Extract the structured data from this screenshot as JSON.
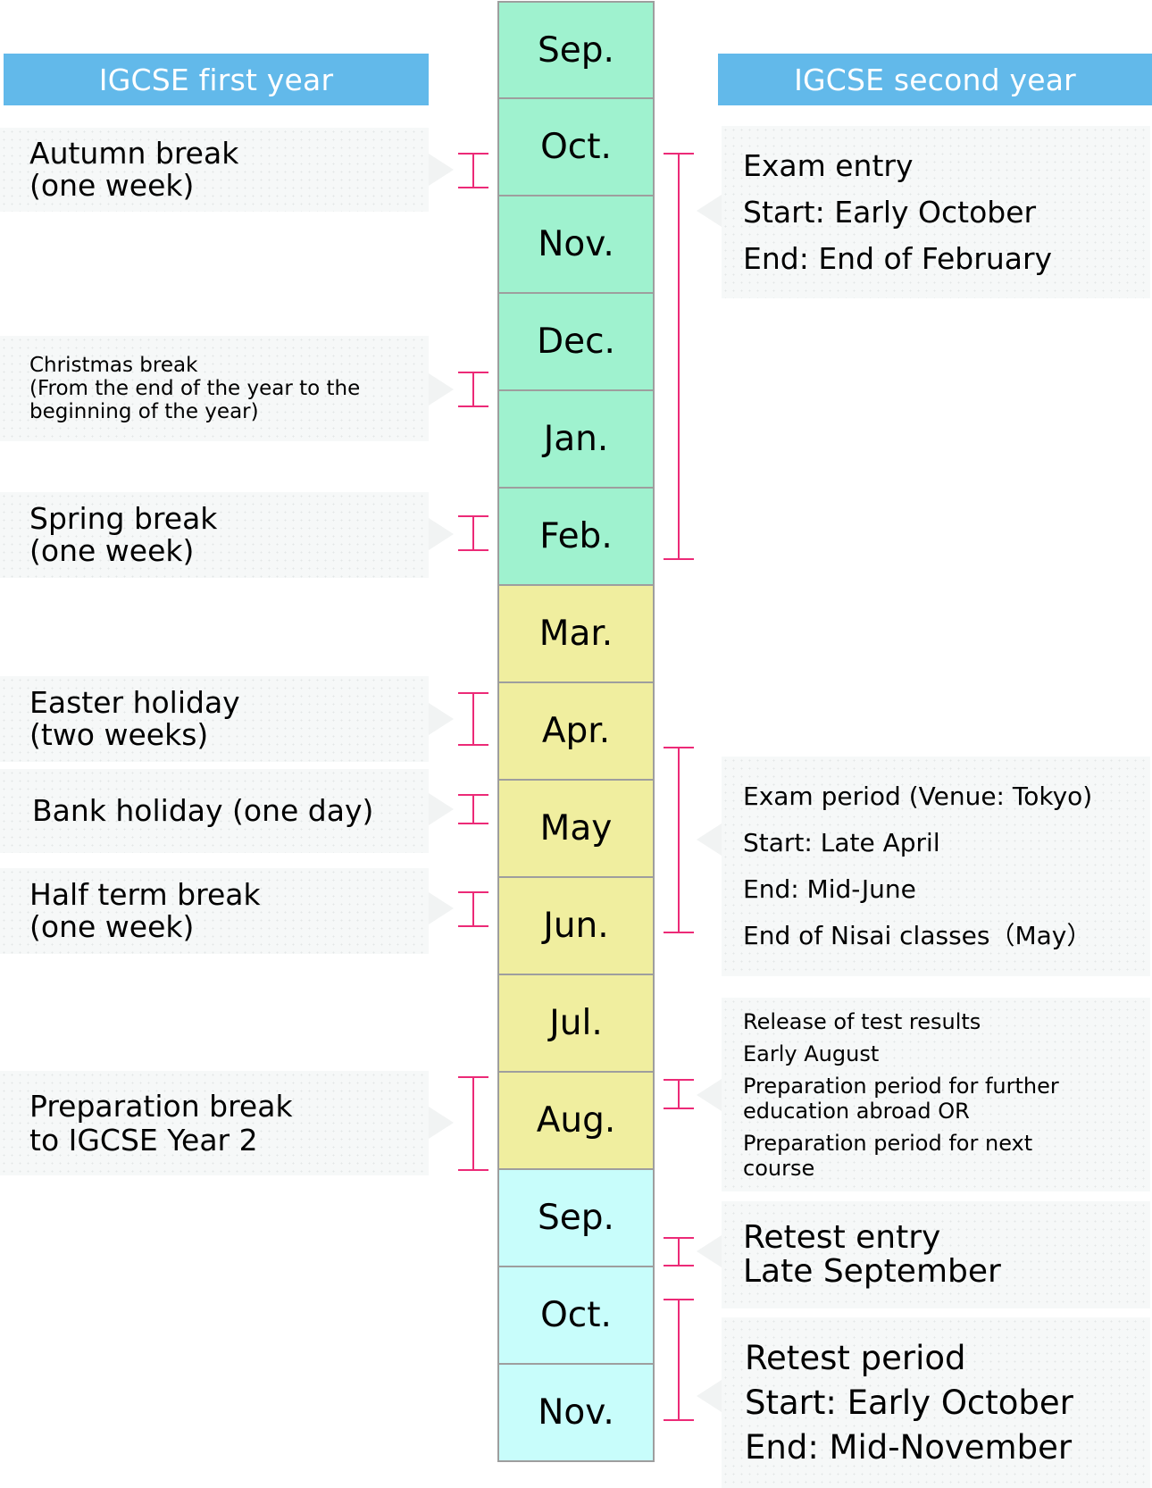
{
  "headers": {
    "first_year": "IGCSE first year",
    "second_year": "IGCSE second year"
  },
  "colors": {
    "header_bg": "#62b9ea",
    "bracket": "#ec2a77",
    "year1_autumn_winter": "#9ff2cf",
    "year1_spring_summer": "#f0ee9f",
    "year2": "#c8fdfb"
  },
  "months": [
    {
      "label": "Sep."
    },
    {
      "label": "Oct."
    },
    {
      "label": "Nov."
    },
    {
      "label": "Dec."
    },
    {
      "label": "Jan."
    },
    {
      "label": "Feb."
    },
    {
      "label": "Mar."
    },
    {
      "label": "Apr."
    },
    {
      "label": "May"
    },
    {
      "label": "Jun."
    },
    {
      "label": "Jul."
    },
    {
      "label": "Aug."
    },
    {
      "label": "Sep."
    },
    {
      "label": "Oct."
    },
    {
      "label": "Nov."
    }
  ],
  "first_year_events": [
    {
      "lines": [
        "Autumn break",
        "(one week)"
      ]
    },
    {
      "lines": [
        "Christmas break",
        "(From the end of the year to the",
        "beginning of the year)"
      ]
    },
    {
      "lines": [
        "Spring break",
        "(one week)"
      ]
    },
    {
      "lines": [
        "Easter holiday",
        "(two weeks)"
      ]
    },
    {
      "lines": [
        "Bank holiday (one day)"
      ]
    },
    {
      "lines": [
        "Half term break",
        "(one week)"
      ]
    },
    {
      "lines": [
        "Preparation break",
        "to IGCSE Year 2"
      ]
    }
  ],
  "second_year_events": [
    {
      "lines": [
        "Exam entry",
        "Start: Early October",
        "End: End of February"
      ]
    },
    {
      "lines": [
        "Exam period (Venue: Tokyo)",
        "Start: Late April",
        "End: Mid-June",
        "End of Nisai classes（May）"
      ]
    },
    {
      "lines": [
        "Release of test results",
        "Early August",
        "Preparation period for further",
        "education abroad OR",
        "Preparation period for next",
        "course"
      ]
    },
    {
      "lines": [
        "Retest entry",
        "Late September"
      ]
    },
    {
      "lines": [
        "Retest period",
        "Start: Early October",
        "End: Mid-November"
      ]
    }
  ]
}
